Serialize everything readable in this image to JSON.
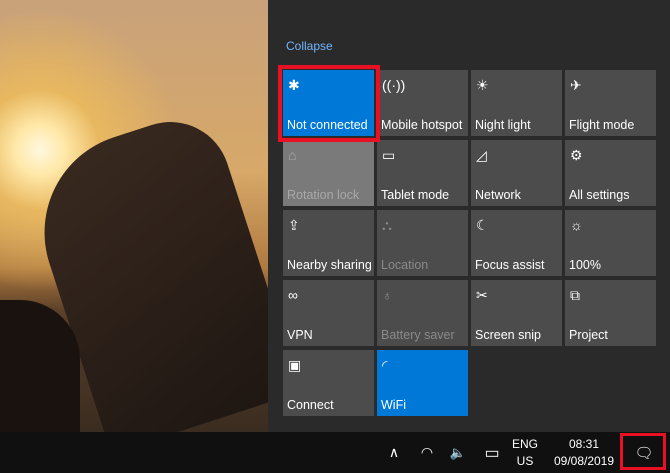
{
  "action_center": {
    "collapse_label": "Collapse",
    "tiles": [
      {
        "label": "Not connected",
        "icon": "bluetooth-icon",
        "glyph": "✱",
        "state": "on"
      },
      {
        "label": "Mobile hotspot",
        "icon": "hotspot-icon",
        "glyph": "((·))",
        "state": "off"
      },
      {
        "label": "Night light",
        "icon": "night-light-icon",
        "glyph": "☀",
        "state": "off"
      },
      {
        "label": "Flight mode",
        "icon": "airplane-icon",
        "glyph": "✈",
        "state": "off"
      },
      {
        "label": "Rotation lock",
        "icon": "rotation-lock-icon",
        "glyph": "⌂",
        "state": "disabled-light"
      },
      {
        "label": "Tablet mode",
        "icon": "tablet-mode-icon",
        "glyph": "▭",
        "state": "off"
      },
      {
        "label": "Network",
        "icon": "network-icon",
        "glyph": "◿",
        "state": "off"
      },
      {
        "label": "All settings",
        "icon": "gear-icon",
        "glyph": "⚙",
        "state": "off"
      },
      {
        "label": "Nearby sharing",
        "icon": "nearby-sharing-icon",
        "glyph": "⇪",
        "state": "off"
      },
      {
        "label": "Location",
        "icon": "location-icon",
        "glyph": "⛬",
        "state": "disabled"
      },
      {
        "label": "Focus assist",
        "icon": "moon-icon",
        "glyph": "☾",
        "state": "off"
      },
      {
        "label": "100%",
        "icon": "brightness-icon",
        "glyph": "☼",
        "state": "off"
      },
      {
        "label": "VPN",
        "icon": "vpn-icon",
        "glyph": "∞",
        "state": "off"
      },
      {
        "label": "Battery saver",
        "icon": "battery-saver-icon",
        "glyph": "♁",
        "state": "disabled"
      },
      {
        "label": "Screen snip",
        "icon": "screen-snip-icon",
        "glyph": "✂",
        "state": "off"
      },
      {
        "label": "Project",
        "icon": "project-icon",
        "glyph": "⧉",
        "state": "off"
      },
      {
        "label": "Connect",
        "icon": "connect-icon",
        "glyph": "▣",
        "state": "off"
      },
      {
        "label": "WiFi",
        "icon": "wifi-icon",
        "glyph": "◜",
        "state": "on"
      }
    ]
  },
  "taskbar": {
    "chevron": "∧",
    "wifi": "◠",
    "volume": "🔈",
    "battery": "▭",
    "lang_top": "ENG",
    "lang_bottom": "US",
    "time": "08:31",
    "date": "09/08/2019",
    "notification": "🗨"
  },
  "colors": {
    "accent": "#0078d7",
    "highlight": "#e81123"
  }
}
